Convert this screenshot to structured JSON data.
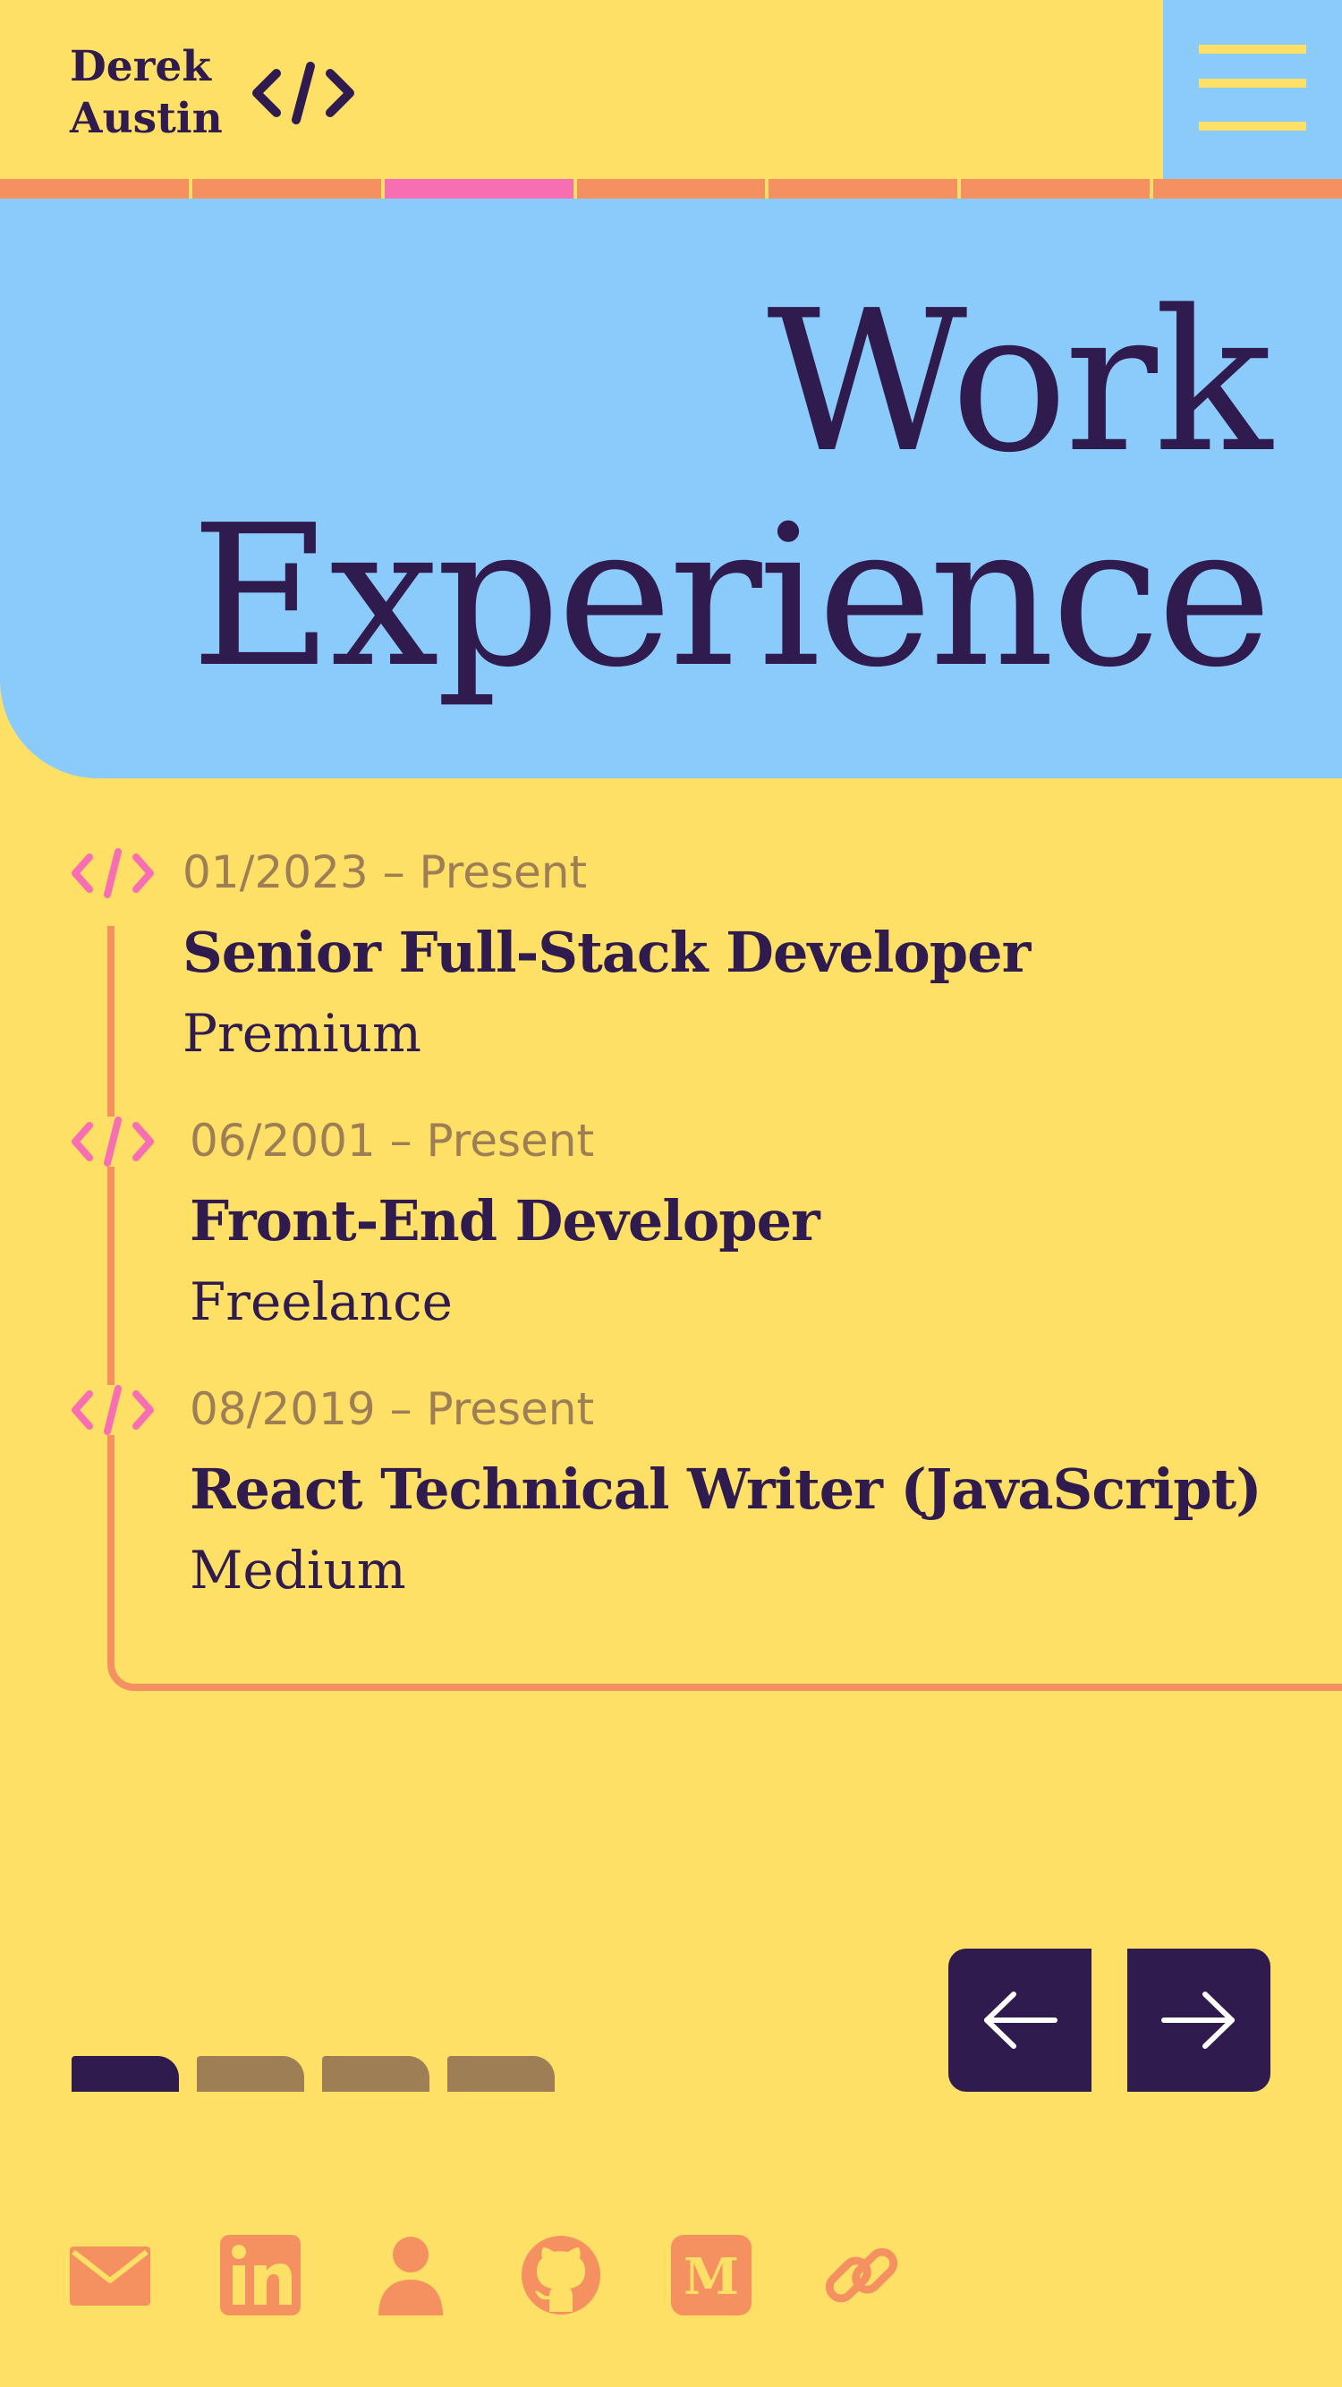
{
  "brand": {
    "name_line1": "Derek",
    "name_line2": "Austin",
    "logo_icon": "code-brackets-icon"
  },
  "menu": {
    "icon": "hamburger-menu-icon"
  },
  "nav_progress": {
    "segments": 7,
    "active_index": 2,
    "active_color": "#F76EB2",
    "inactive_color": "#F59060"
  },
  "hero": {
    "title_line1": "Work",
    "title_line2": "Experience",
    "background": "#8ACBFC"
  },
  "experience": [
    {
      "date": "01/2023 – Present",
      "role": "Senior Full-Stack Developer",
      "company": "Premium",
      "icon": "code-brackets-icon"
    },
    {
      "date": "06/2001 – Present",
      "role": "Front-End Developer",
      "company": "Freelance",
      "icon": "code-brackets-icon"
    },
    {
      "date": "08/2019 – Present",
      "role": "React Technical Writer (JavaScript)",
      "company": "Medium",
      "icon": "code-brackets-icon"
    }
  ],
  "pager": {
    "page_count": 4,
    "active_index": 0,
    "prev_icon": "arrow-left-icon",
    "next_icon": "arrow-right-icon"
  },
  "social": [
    {
      "name": "email",
      "icon": "mail-icon"
    },
    {
      "name": "linkedin",
      "icon": "linkedin-icon"
    },
    {
      "name": "profile",
      "icon": "person-icon"
    },
    {
      "name": "github",
      "icon": "github-icon"
    },
    {
      "name": "medium",
      "icon": "medium-icon"
    },
    {
      "name": "link",
      "icon": "link-icon"
    }
  ],
  "colors": {
    "background": "#FFE066",
    "primary": "#2F1B4E",
    "accent_orange": "#F59060",
    "accent_pink": "#F76EB2",
    "sky": "#8ACBFC",
    "muted": "#9E7E55"
  }
}
